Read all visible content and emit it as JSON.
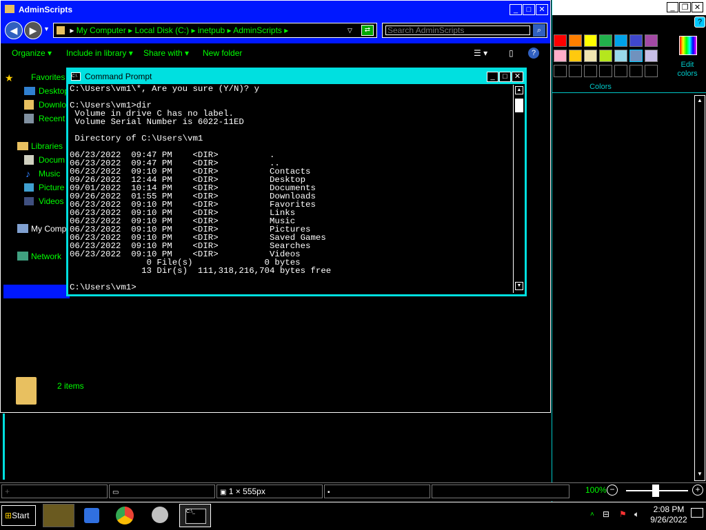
{
  "explorer": {
    "title": "AdminScripts",
    "breadcrumb": [
      "My Computer",
      "Local Disk (C:)",
      "inetpub",
      "AdminScripts"
    ],
    "search_placeholder": "Search AdminScripts",
    "toolbar": {
      "organize": "Organize",
      "include_in_library": "Include in library",
      "share_with": "Share with",
      "new_folder": "New folder"
    },
    "nav": {
      "favorites": "Favorites",
      "desktop": "Desktop",
      "downloads": "Downlo",
      "recent": "Recent",
      "libraries": "Libraries",
      "documents": "Docum",
      "music": "Music",
      "pictures": "Picture",
      "videos": "Videos",
      "my_computer": "My Comp",
      "network": "Network"
    },
    "item_count": "2 items"
  },
  "cmd": {
    "title": "Command Prompt",
    "lines": [
      "C:\\Users\\vm1\\*, Are you sure (Y/N)? y",
      "",
      "C:\\Users\\vm1>dir",
      " Volume in drive C has no label.",
      " Volume Serial Number is 6022-11ED",
      "",
      " Directory of C:\\Users\\vm1",
      "",
      "06/23/2022  09:47 PM    <DIR>          .",
      "06/23/2022  09:47 PM    <DIR>          ..",
      "06/23/2022  09:10 PM    <DIR>          Contacts",
      "09/26/2022  12:44 PM    <DIR>          Desktop",
      "09/01/2022  10:14 PM    <DIR>          Documents",
      "09/26/2022  01:55 PM    <DIR>          Downloads",
      "06/23/2022  09:10 PM    <DIR>          Favorites",
      "06/23/2022  09:10 PM    <DIR>          Links",
      "06/23/2022  09:10 PM    <DIR>          Music",
      "06/23/2022  09:10 PM    <DIR>          Pictures",
      "06/23/2022  09:10 PM    <DIR>          Saved Games",
      "06/23/2022  09:10 PM    <DIR>          Searches",
      "06/23/2022  09:10 PM    <DIR>          Videos",
      "               0 File(s)              0 bytes",
      "              13 Dir(s)  111,318,216,704 bytes free",
      "",
      "C:\\Users\\vm1>"
    ]
  },
  "paint": {
    "colors_label": "Colors",
    "edit_colors": "Edit colors",
    "palette_row1": [
      "#ff0000",
      "#ff7f00",
      "#ffff00",
      "#22b14c",
      "#00a2e8",
      "#3f48cc",
      "#a349a4"
    ],
    "palette_row2": [
      "#ffaec9",
      "#ffc90e",
      "#efe4b0",
      "#b5e61d",
      "#99d9ea",
      "#7092be",
      "#c8bfe7"
    ],
    "image_size": "1 × 555px",
    "zoom": "100%"
  },
  "taskbar": {
    "start": "Start",
    "time": "2:08 PM",
    "date": "9/26/2022"
  }
}
